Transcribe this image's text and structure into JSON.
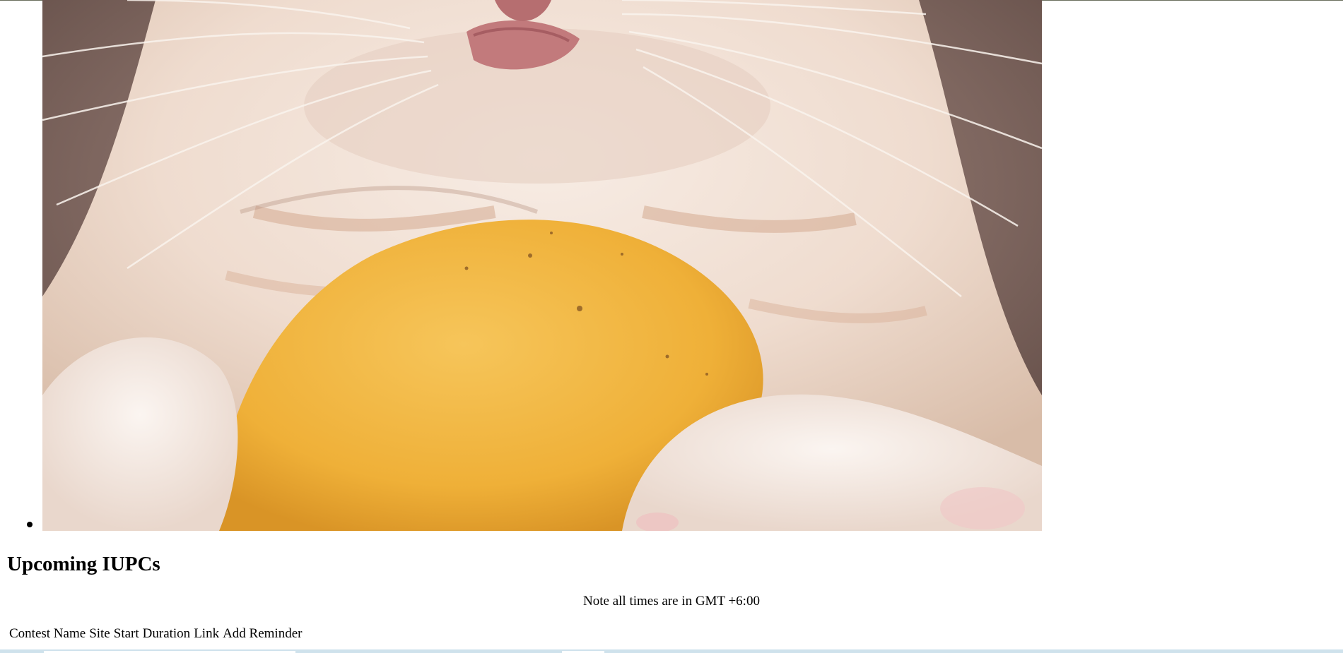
{
  "carousel": {
    "slide_image_alt": "Kitten holding a mango"
  },
  "section": {
    "title": "Upcoming IUPCs",
    "note": "Note all times are in GMT +6:00"
  },
  "table": {
    "headers": [
      "Contest Name",
      "Site",
      "Start",
      "Duration",
      "Link",
      "Add Reminder"
    ]
  },
  "colors": {
    "background": "#ffffff",
    "text": "#000000",
    "mango": "#f2b43c",
    "fur": "#f1e2d8",
    "backdrop": "#8a7068"
  }
}
